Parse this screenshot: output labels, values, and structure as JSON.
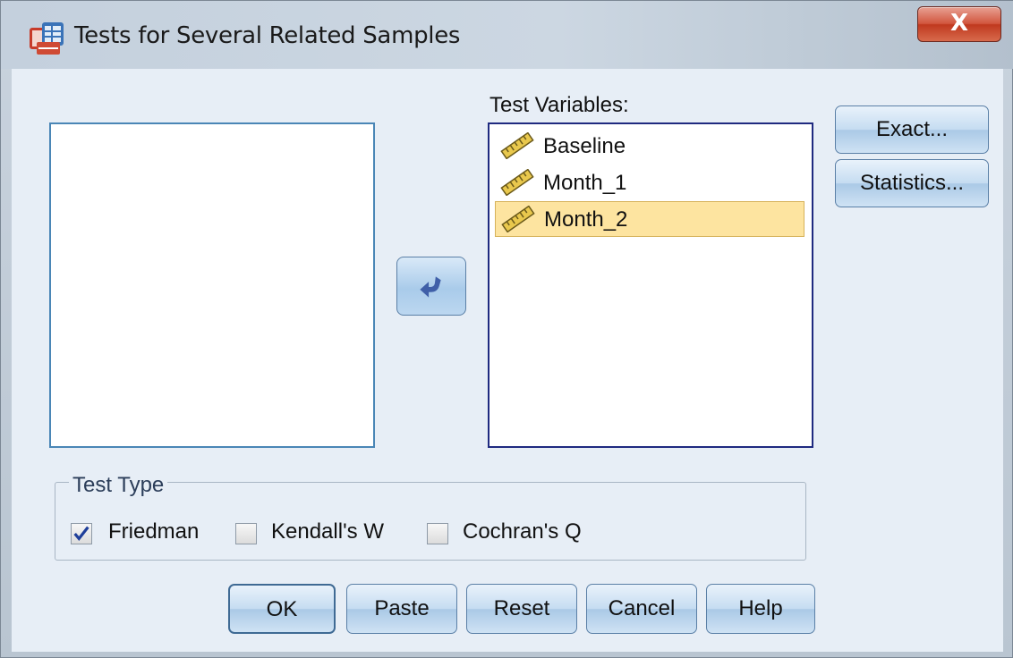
{
  "window": {
    "title": "Tests for Several Related Samples",
    "close_glyph": "X"
  },
  "lists": {
    "target_label": "Test Variables:",
    "target_items": [
      "Baseline",
      "Month_1",
      "Month_2"
    ],
    "selected_item": "Month_2"
  },
  "side_buttons": {
    "exact": "Exact...",
    "statistics": "Statistics..."
  },
  "test_type": {
    "legend": "Test Type",
    "friedman": {
      "label": "Friedman",
      "checked": true
    },
    "kendall": {
      "label": "Kendall's W",
      "checked": false
    },
    "cochran": {
      "label": "Cochran's Q",
      "checked": false
    }
  },
  "buttons": {
    "ok": "OK",
    "paste": "Paste",
    "reset": "Reset",
    "cancel": "Cancel",
    "help": "Help"
  },
  "icons": {
    "app": "spss-table-icon",
    "move": "move-left-arrow-icon",
    "variable": "scale-ruler-icon"
  },
  "colors": {
    "selection": "#fde4a0",
    "accent": "#4a86b6",
    "close": "#c0391f"
  }
}
